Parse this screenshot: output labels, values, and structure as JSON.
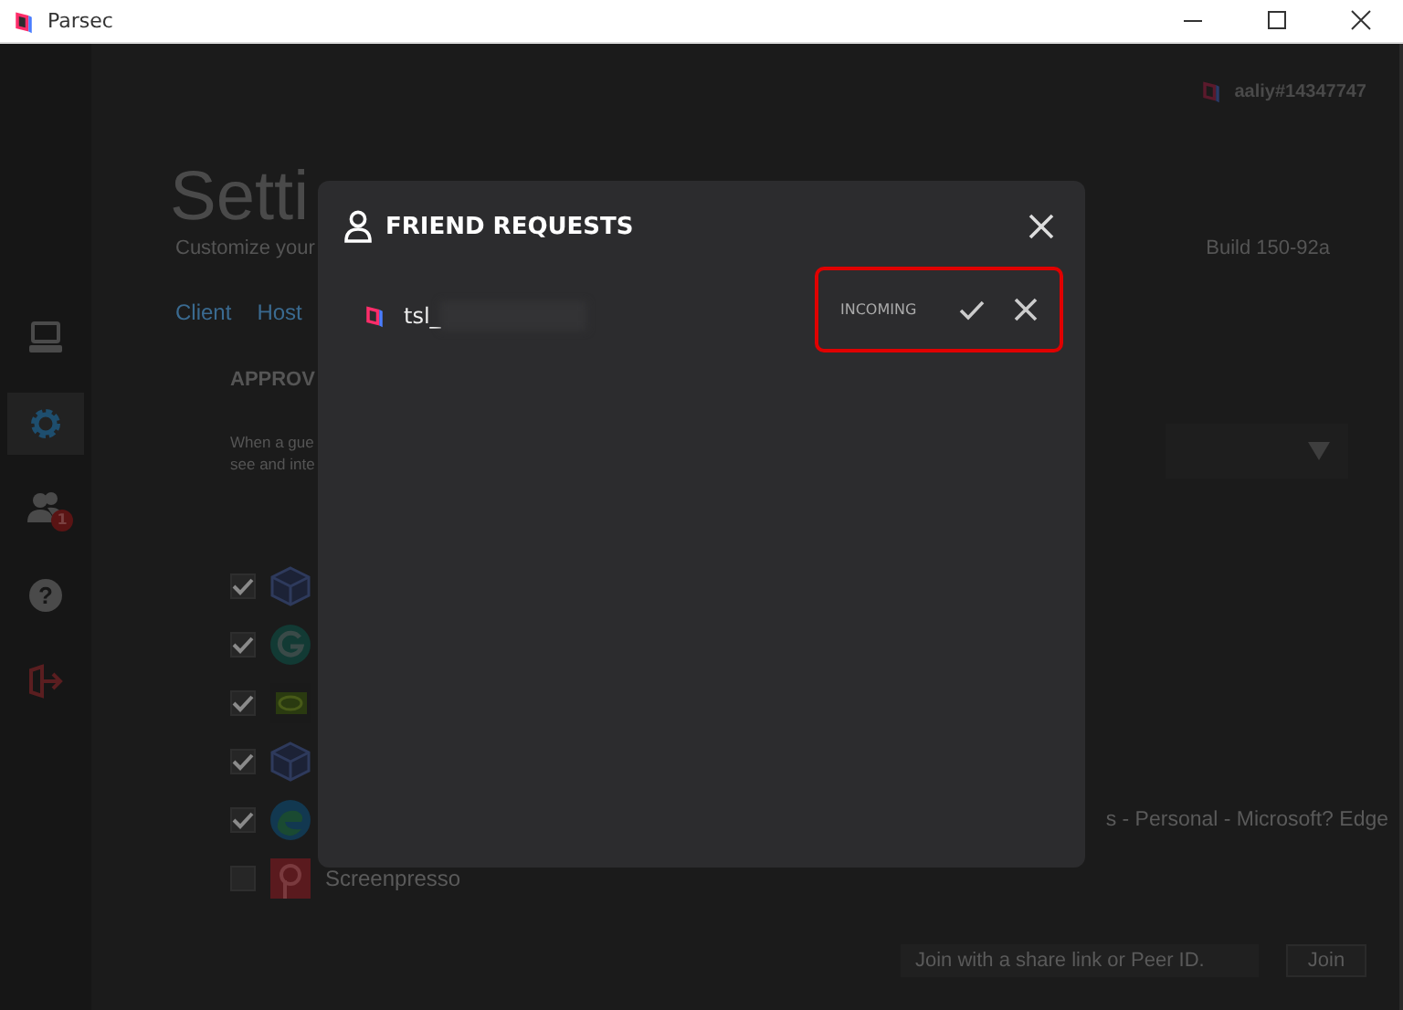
{
  "window": {
    "title": "Parsec"
  },
  "nav": [
    {
      "kind": "computer",
      "selected": false
    },
    {
      "kind": "gear",
      "selected": true
    },
    {
      "kind": "friends",
      "selected": false,
      "badge": "1"
    },
    {
      "kind": "help",
      "selected": false,
      "glyph": "?"
    },
    {
      "kind": "logout",
      "selected": false
    }
  ],
  "user": {
    "name": "aaliy#14347747"
  },
  "page": {
    "title": "Setti",
    "subtitle": "Customize your",
    "build": "Build 150-92a"
  },
  "tabs": [
    {
      "label": "Client",
      "selected": false
    },
    {
      "label": "Host",
      "selected": false
    }
  ],
  "section": {
    "heading": "APPROV",
    "description": [
      "When a gue",
      "see and inte"
    ]
  },
  "apps": [
    {
      "kind": "box",
      "checked": true
    },
    {
      "kind": "g",
      "checked": true
    },
    {
      "kind": "eye",
      "checked": true
    },
    {
      "kind": "box",
      "checked": true
    },
    {
      "kind": "edge",
      "checked": true,
      "label": "s - Personal - Microsoft? Edge"
    },
    {
      "kind": "screenpresso",
      "checked": false,
      "label": "Screenpresso"
    }
  ],
  "join": {
    "placeholder": "Join with a share link or Peer ID.",
    "button": "Join"
  },
  "dialog": {
    "title": "FRIEND REQUESTS",
    "requests": [
      {
        "name": "tsl_",
        "redacted": true,
        "status": "INCOMING",
        "highlighted": true
      }
    ]
  }
}
